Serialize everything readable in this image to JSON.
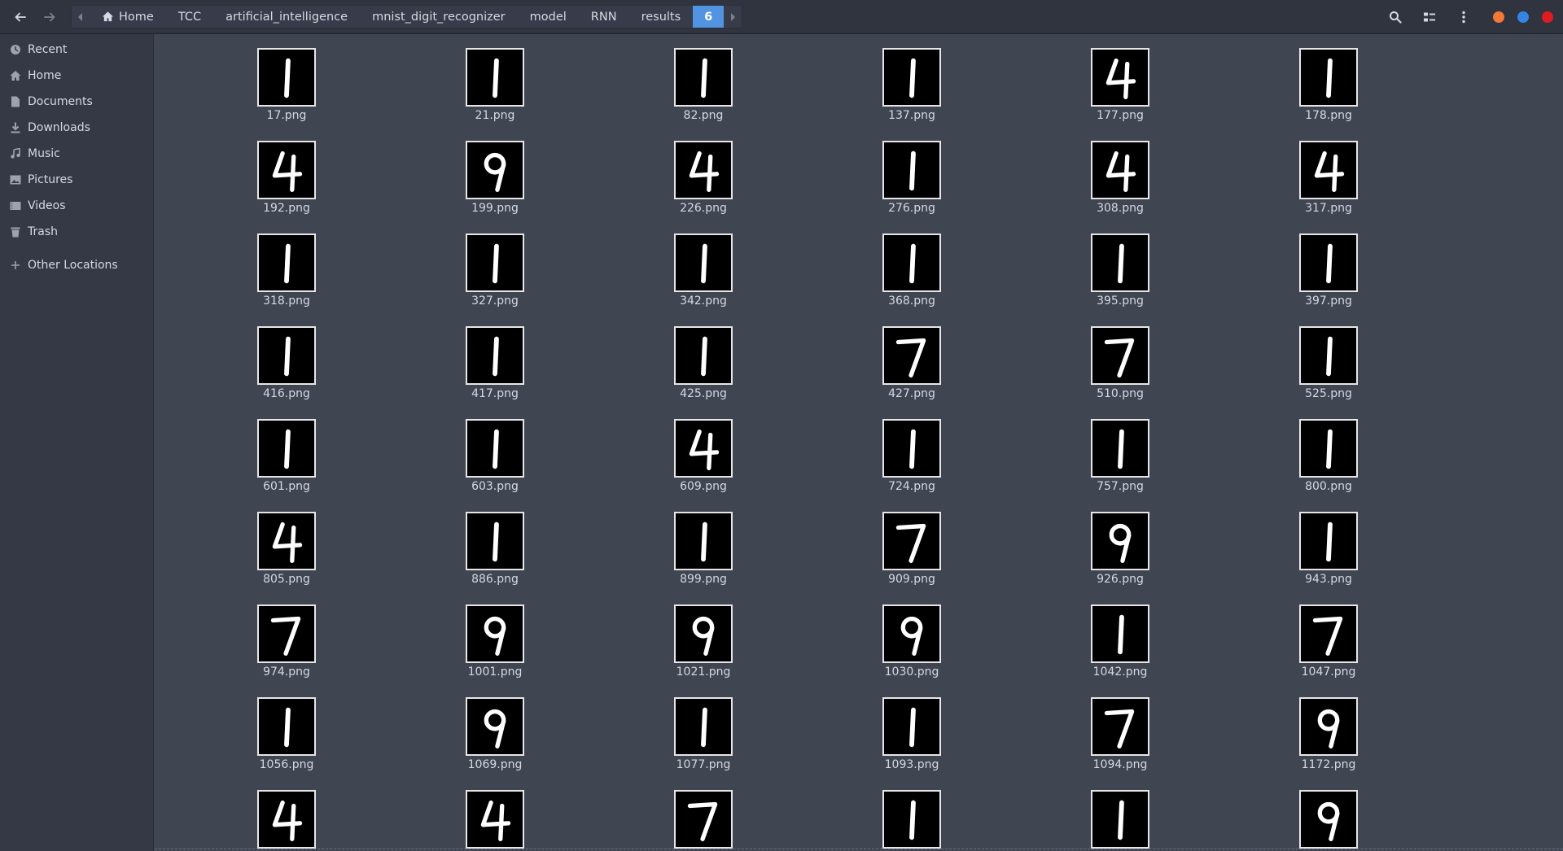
{
  "header": {
    "breadcrumbs": [
      "Home",
      "TCC",
      "artificial_intelligence",
      "mnist_digit_recognizer",
      "model",
      "RNN",
      "results",
      "6"
    ],
    "window_dot_colors": [
      "#f27835",
      "#3584e4",
      "#e01b24"
    ],
    "accent": "#5294e2",
    "icons": [
      "back-arrow-icon",
      "forward-arrow-icon",
      "search-icon",
      "view-toggle-icon",
      "menu-icon"
    ]
  },
  "sidebar": {
    "items": [
      {
        "label": "Recent",
        "icon": "clock-icon"
      },
      {
        "label": "Home",
        "icon": "home-icon"
      },
      {
        "label": "Documents",
        "icon": "document-icon"
      },
      {
        "label": "Downloads",
        "icon": "download-icon"
      },
      {
        "label": "Music",
        "icon": "music-icon"
      },
      {
        "label": "Pictures",
        "icon": "picture-icon"
      },
      {
        "label": "Videos",
        "icon": "video-icon"
      },
      {
        "label": "Trash",
        "icon": "trash-icon"
      },
      {
        "label": "Other Locations",
        "icon": "plus-icon"
      }
    ]
  },
  "files": [
    {
      "name": "17.png",
      "digit": "1"
    },
    {
      "name": "21.png",
      "digit": "1"
    },
    {
      "name": "82.png",
      "digit": "1"
    },
    {
      "name": "137.png",
      "digit": "1"
    },
    {
      "name": "177.png",
      "digit": "4"
    },
    {
      "name": "178.png",
      "digit": "1"
    },
    {
      "name": "192.png",
      "digit": "4"
    },
    {
      "name": "199.png",
      "digit": "9"
    },
    {
      "name": "226.png",
      "digit": "4"
    },
    {
      "name": "276.png",
      "digit": "1"
    },
    {
      "name": "308.png",
      "digit": "4"
    },
    {
      "name": "317.png",
      "digit": "4"
    },
    {
      "name": "318.png",
      "digit": "1"
    },
    {
      "name": "327.png",
      "digit": "1"
    },
    {
      "name": "342.png",
      "digit": "1"
    },
    {
      "name": "368.png",
      "digit": "1"
    },
    {
      "name": "395.png",
      "digit": "1"
    },
    {
      "name": "397.png",
      "digit": "1"
    },
    {
      "name": "416.png",
      "digit": "1"
    },
    {
      "name": "417.png",
      "digit": "1"
    },
    {
      "name": "425.png",
      "digit": "1"
    },
    {
      "name": "427.png",
      "digit": "7"
    },
    {
      "name": "510.png",
      "digit": "7"
    },
    {
      "name": "525.png",
      "digit": "1"
    },
    {
      "name": "601.png",
      "digit": "1"
    },
    {
      "name": "603.png",
      "digit": "1"
    },
    {
      "name": "609.png",
      "digit": "4"
    },
    {
      "name": "724.png",
      "digit": "1"
    },
    {
      "name": "757.png",
      "digit": "1"
    },
    {
      "name": "800.png",
      "digit": "1"
    },
    {
      "name": "805.png",
      "digit": "4"
    },
    {
      "name": "886.png",
      "digit": "1"
    },
    {
      "name": "899.png",
      "digit": "1"
    },
    {
      "name": "909.png",
      "digit": "7"
    },
    {
      "name": "926.png",
      "digit": "9"
    },
    {
      "name": "943.png",
      "digit": "1"
    },
    {
      "name": "974.png",
      "digit": "7"
    },
    {
      "name": "1001.png",
      "digit": "9"
    },
    {
      "name": "1021.png",
      "digit": "9"
    },
    {
      "name": "1030.png",
      "digit": "9"
    },
    {
      "name": "1042.png",
      "digit": "1"
    },
    {
      "name": "1047.png",
      "digit": "7"
    },
    {
      "name": "1056.png",
      "digit": "1"
    },
    {
      "name": "1069.png",
      "digit": "9"
    },
    {
      "name": "1077.png",
      "digit": "1"
    },
    {
      "name": "1093.png",
      "digit": "1"
    },
    {
      "name": "1094.png",
      "digit": "7"
    },
    {
      "name": "1172.png",
      "digit": "9"
    },
    {
      "name": "",
      "digit": "4"
    },
    {
      "name": "",
      "digit": "4"
    },
    {
      "name": "",
      "digit": "7"
    },
    {
      "name": "",
      "digit": "1"
    },
    {
      "name": "",
      "digit": "1"
    },
    {
      "name": "",
      "digit": "9"
    }
  ]
}
